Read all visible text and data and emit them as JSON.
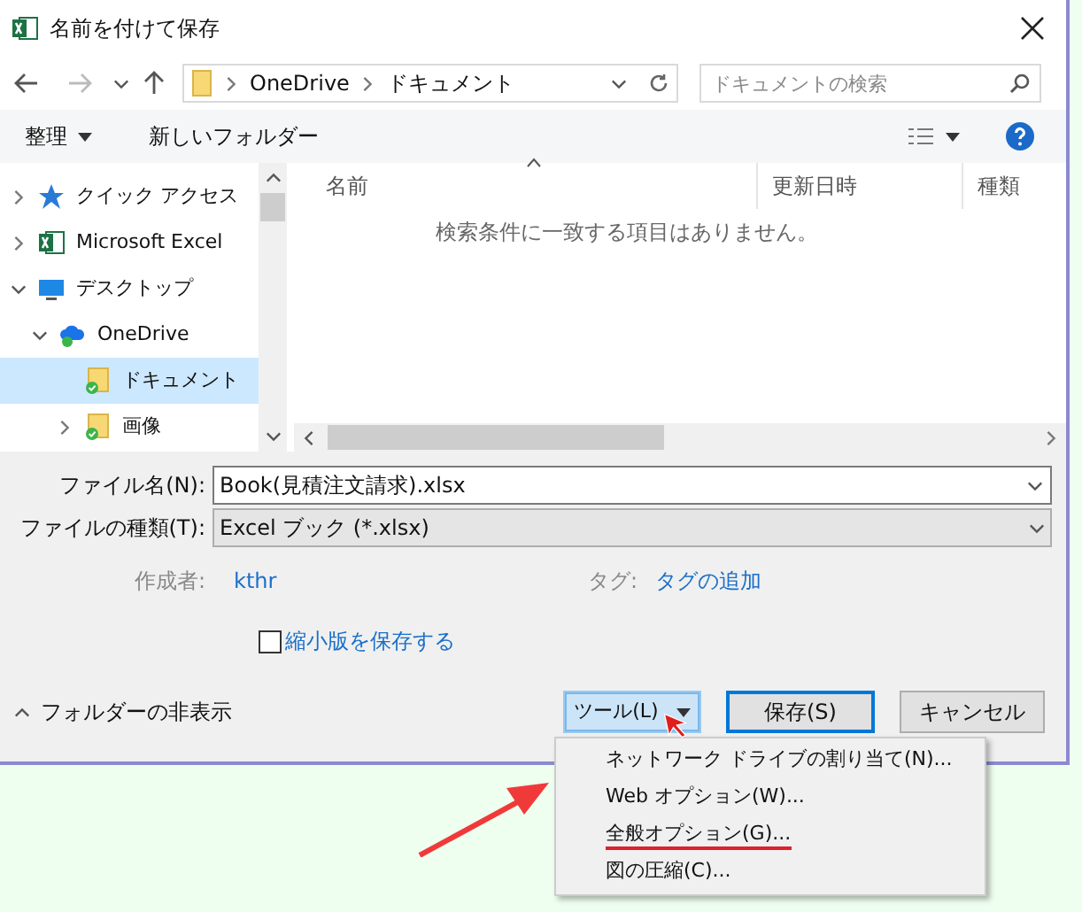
{
  "window": {
    "title": "名前を付けて保存"
  },
  "address_bar": {
    "path": [
      "OneDrive",
      "ドキュメント"
    ]
  },
  "search": {
    "placeholder": "ドキュメントの検索"
  },
  "toolbar": {
    "organize": "整理",
    "new_folder": "新しいフォルダー"
  },
  "nav": {
    "items": [
      {
        "label": "クイック アクセス",
        "kind": "star",
        "expanded": false,
        "selected": false
      },
      {
        "label": "Microsoft Excel",
        "kind": "excel",
        "expanded": false,
        "selected": false
      },
      {
        "label": "デスクトップ",
        "kind": "desktop",
        "expanded": true,
        "selected": false,
        "children": [
          {
            "label": "OneDrive",
            "kind": "cloud",
            "expanded": true,
            "selected": false,
            "children": [
              {
                "label": "ドキュメント",
                "kind": "folder",
                "selected": true
              },
              {
                "label": "画像",
                "kind": "folder",
                "expanded": false,
                "selected": false
              }
            ]
          }
        ]
      }
    ]
  },
  "file_list": {
    "columns": [
      {
        "label": "名前",
        "sorted": true
      },
      {
        "label": "更新日時",
        "sorted": false
      },
      {
        "label": "種類",
        "sorted": false
      }
    ],
    "empty_message": "検索条件に一致する項目はありません。"
  },
  "form": {
    "file_name": {
      "label": "ファイル名(N):",
      "value": "Book(見積注文請求).xlsx"
    },
    "file_type": {
      "label": "ファイルの種類(T):",
      "value": "Excel ブック (*.xlsx)"
    },
    "author": {
      "label": "作成者:",
      "value": "kthr"
    },
    "tags": {
      "label": "タグ:",
      "value": "タグの追加"
    },
    "thumbnail": {
      "label": "縮小版を保存する",
      "checked": false
    }
  },
  "footer": {
    "hide_folders": "フォルダーの非表示",
    "buttons": [
      {
        "label": "ツール(L)",
        "kind": "menu",
        "pressed": true
      },
      {
        "label": "保存(S)",
        "kind": "default",
        "pressed": false
      },
      {
        "label": "キャンセル",
        "kind": "normal",
        "pressed": false
      }
    ]
  },
  "tools_menu": {
    "items": [
      {
        "label": "ネットワーク ドライブの割り当て(N)...",
        "marked": false
      },
      {
        "label": "Web オプション(W)...",
        "marked": false
      },
      {
        "label": "全般オプション(G)...",
        "marked": true
      },
      {
        "label": "図の圧縮(C)...",
        "marked": false
      }
    ]
  }
}
